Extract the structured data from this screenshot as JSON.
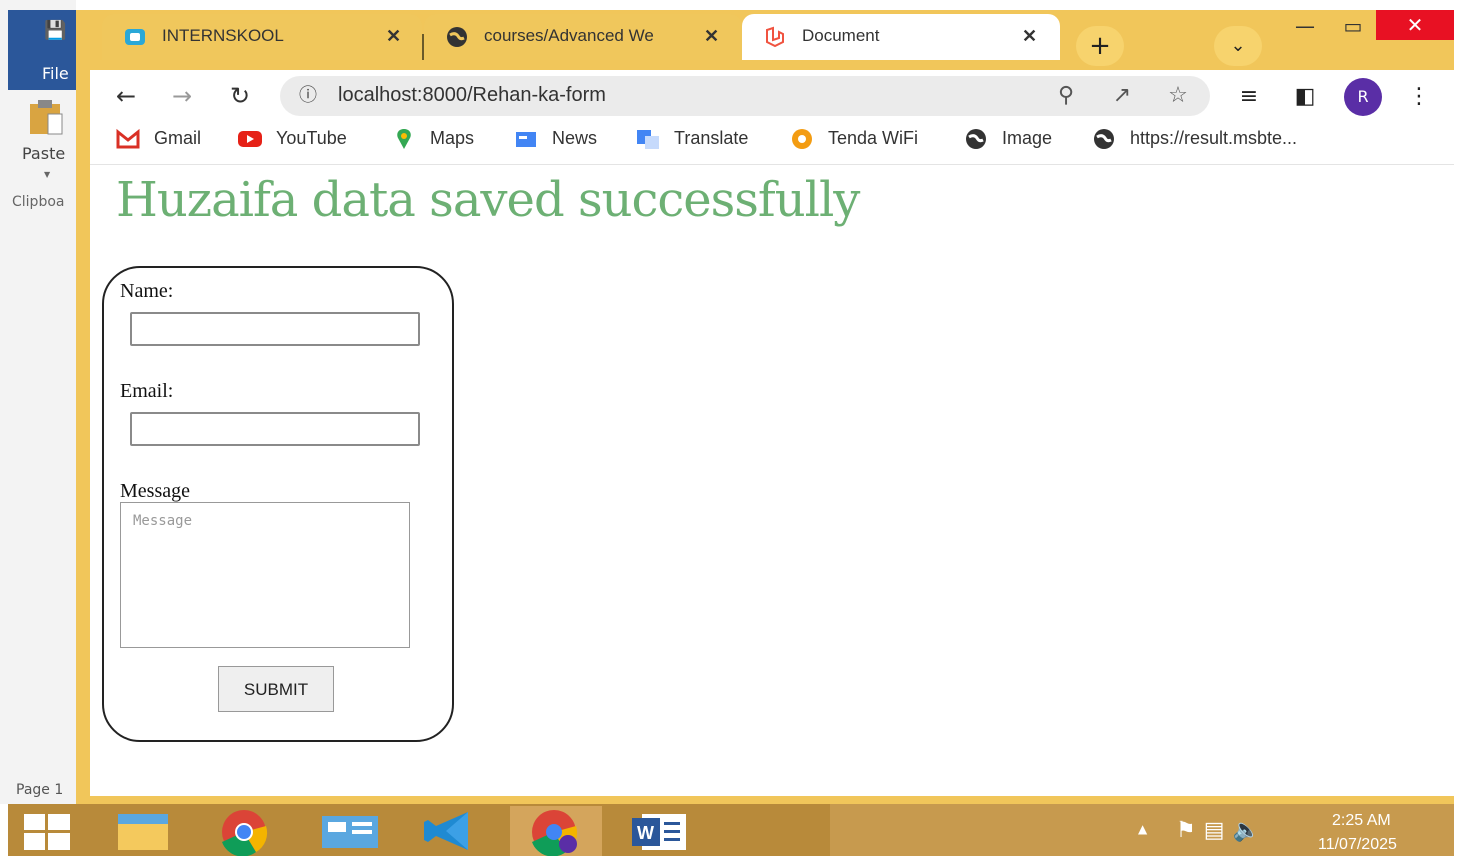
{
  "word": {
    "file_label": "File",
    "paste_label": "Paste",
    "clipboard_label": "Clipboa",
    "page_label": "Page 1"
  },
  "browser": {
    "tabs": [
      {
        "title": "INTERNSKOOL",
        "icon": "internskool-favicon"
      },
      {
        "title": "courses/Advanced We",
        "icon": "globe-icon"
      },
      {
        "title": "Document",
        "icon": "laravel-favicon",
        "active": true
      }
    ],
    "url": "localhost:8000/Rehan-ka-form",
    "avatar_letter": "R",
    "bookmarks": [
      {
        "label": "Gmail",
        "icon": "gmail-icon"
      },
      {
        "label": "YouTube",
        "icon": "youtube-icon"
      },
      {
        "label": "Maps",
        "icon": "maps-icon"
      },
      {
        "label": "News",
        "icon": "news-icon"
      },
      {
        "label": "Translate",
        "icon": "translate-icon"
      },
      {
        "label": "Tenda WiFi",
        "icon": "tenda-icon"
      },
      {
        "label": "Image",
        "icon": "globe-icon"
      },
      {
        "label": "https://result.msbte...",
        "icon": "globe-icon"
      }
    ]
  },
  "page": {
    "heading": "Huzaifa data saved successfully",
    "form": {
      "name_label": "Name:",
      "name_value": "",
      "email_label": "Email:",
      "email_value": "",
      "message_label": "Message",
      "message_placeholder": "Message",
      "submit_label": "SUBMIT"
    }
  },
  "taskbar": {
    "apps": [
      "file-explorer",
      "chrome",
      "control-panel",
      "vscode",
      "chrome-profile",
      "word"
    ],
    "time": "2:25 AM",
    "date": "11/07/2025"
  },
  "colors": {
    "chrome_frame": "#f1c65a",
    "heading": "#6db074",
    "taskbar": "#b88a3a",
    "avatar": "#5a2ea6"
  }
}
